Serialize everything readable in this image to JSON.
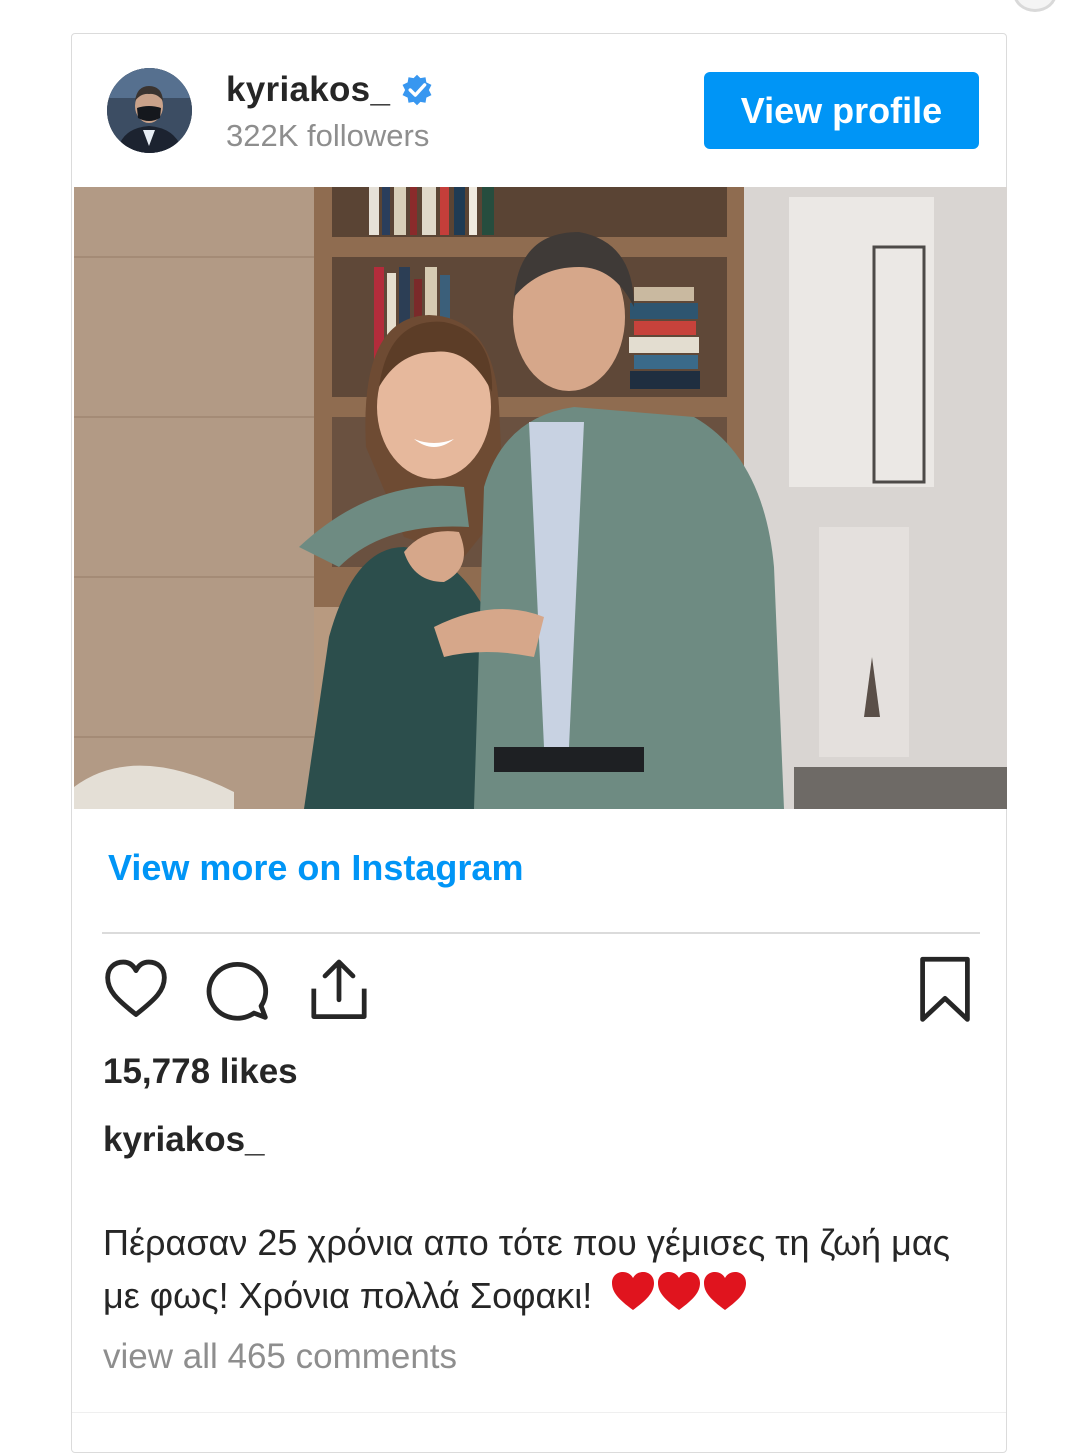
{
  "post": {
    "username": "kyriakos_",
    "followers": "322K followers",
    "view_profile_label": "View profile",
    "photo_alt": "Photo",
    "view_more_label": "View more on Instagram",
    "likes": "15,778 likes",
    "caption_username": "kyriakos_",
    "caption_text": "Πέρασαν 25 χρόνια απο τότε που γέμισες τη ζωή μας με φως! Χρόνια πολλά Σοφακι!",
    "caption_emoji": "❤❤❤",
    "comments_link": "view all 465 comments"
  },
  "icons": {
    "verified": "verified-badge-icon",
    "like": "heart-icon",
    "comment": "comment-bubble-icon",
    "share": "share-icon",
    "save": "bookmark-icon"
  },
  "colors": {
    "accent": "#0095f6",
    "text": "#262626",
    "muted": "#8e8e8e",
    "heart_red": "#e0141e"
  }
}
